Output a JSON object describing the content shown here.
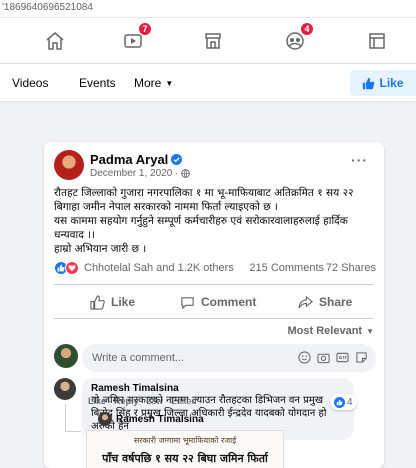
{
  "browser": {
    "url_fragment": "'1869640696521084"
  },
  "nav": {
    "items": [
      {
        "icon": "home-icon"
      },
      {
        "icon": "video-icon",
        "badge": "7"
      },
      {
        "icon": "marketplace-icon"
      },
      {
        "icon": "groups-icon",
        "badge": "4"
      },
      {
        "icon": "pages-icon"
      }
    ]
  },
  "tabs": {
    "videos": "Videos",
    "events": "Events",
    "more": "More",
    "like_button": "Like"
  },
  "post": {
    "author": "Padma Aryal",
    "date": "December 1, 2020 ·",
    "text_lines": [
      "रौतहट जिल्लाको गुजारा नगरपालिका १ मा भू-माफियाबाट अतिक्रमित १ सय २२",
      "बिगाहा जमीन नेपाल सरकारको नाममा फिर्ता ल्याइएको छ ।",
      "यस काममा सहयोग गर्नुहुने सम्पूर्ण कर्मचारीहरु एवं सरोकारवालाहरुलाई हार्दिक",
      "धन्यवाद ।।",
      "हाम्रो अभियान जारी छ ।"
    ],
    "reactions_text": "Chhotelal Sah and 1.2K others",
    "comments_count": "215 Comments",
    "shares_count": "72 Shares",
    "actions": {
      "like": "Like",
      "comment": "Comment",
      "share": "Share"
    },
    "sort_label": "Most Relevant"
  },
  "comment_box": {
    "placeholder": "Write a comment..."
  },
  "comment": {
    "author": "Ramesh Timalsina",
    "text_lines": [
      "यो जमिन सरकारको नाममा ल्याउन रौतहटका डिभिजन वन प्रमुख",
      "बिनोद सिंह र प्रमुख जिल्ला अधिकारी ईन्द्रदेव यादबको योगदान हो",
      "अरुको हैन"
    ],
    "reaction_count": "4",
    "meta_like": "Like",
    "meta_reply": "Reply",
    "meta_time": "28w · Edited"
  },
  "reply": {
    "author": "Ramesh Timalsina",
    "image_line1": "सरकारी जग्गामा भूमाफियाको रजाई",
    "image_line2": "पाँच वर्षपछि १ सय २२ बिघा जमिन फिर्ता"
  },
  "colors": {
    "accent": "#1877f2",
    "badge": "#e41e3f",
    "love": "#f33e58",
    "background": "#f0f2f5"
  }
}
